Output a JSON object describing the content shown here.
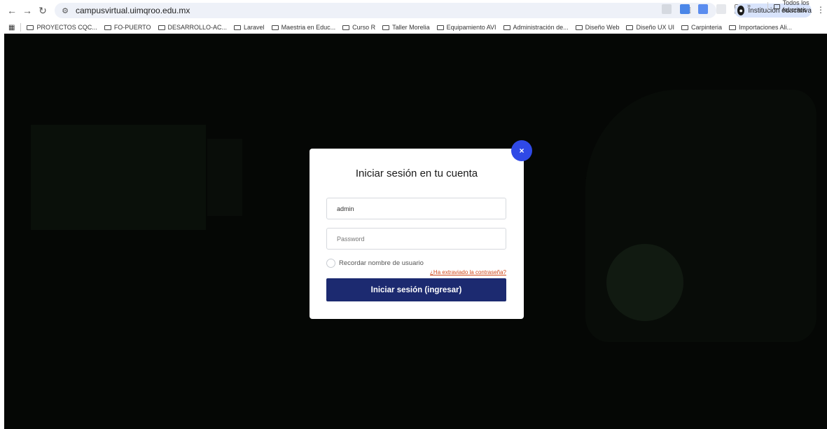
{
  "browser": {
    "url": "campusvirtual.uimqroo.edu.mx",
    "profile_label": "Institución educativa"
  },
  "bookmarks": {
    "items": [
      "PROYECTOS CQC...",
      "FO-PUERTO",
      "DESARROLLO-AC...",
      "Laravel",
      "Maestria en Educ...",
      "Curso R",
      "Taller Morelia",
      "Equipamiento AVI",
      "Administración de...",
      "Diseño Web",
      "Diseño UX UI",
      "Carpinteria",
      "Importaciones Ali..."
    ],
    "more": "»",
    "all_favorites": "Todos los favoritos"
  },
  "login_modal": {
    "title": "Iniciar sesión en tu cuenta",
    "username_value": "admin",
    "password_placeholder": "Password",
    "remember_label": "Recordar nombre de usuario",
    "forgot_link": "¿Ha extraviado la contraseña?",
    "login_button": "Iniciar sesión (ingresar)",
    "close_label": "×"
  },
  "colors": {
    "accent_blue": "#2f49e6",
    "login_button": "#1c2a70",
    "forgot_link": "#d04a1c"
  }
}
